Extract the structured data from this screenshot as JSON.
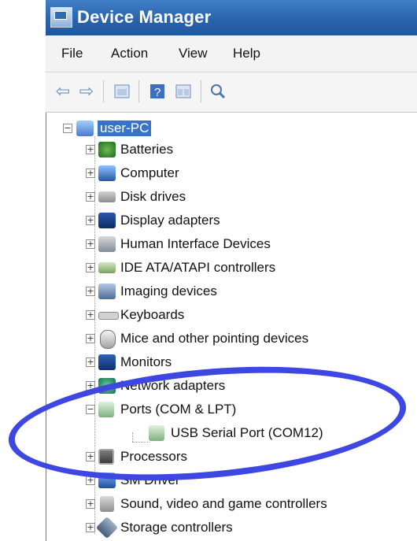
{
  "window": {
    "title": "Device Manager"
  },
  "menu": [
    "File",
    "Action",
    "View",
    "Help"
  ],
  "toolbar": [
    {
      "icon": "back-arrow-icon"
    },
    {
      "icon": "forward-arrow-icon"
    },
    {
      "icon": "properties-panel-icon"
    },
    {
      "icon": "help-icon"
    },
    {
      "icon": "console-panel-icon"
    },
    {
      "icon": "scan-hardware-icon"
    }
  ],
  "tree": {
    "root": "user-PC",
    "items": [
      "Batteries",
      "Computer",
      "Disk drives",
      "Display adapters",
      "Human Interface Devices",
      "IDE ATA/ATAPI controllers",
      "Imaging devices",
      "Keyboards",
      "Mice and other pointing devices",
      "Monitors",
      "Network adapters",
      "Ports (COM & LPT)",
      "Processors",
      "SM Driver",
      "Sound, video and game controllers",
      "Storage controllers"
    ],
    "child": "USB Serial Port (COM12)"
  },
  "colors": {
    "title_bar": "#2a64ad",
    "selected": "#3a72c5",
    "highlight_ellipse": "#3f47e3"
  }
}
